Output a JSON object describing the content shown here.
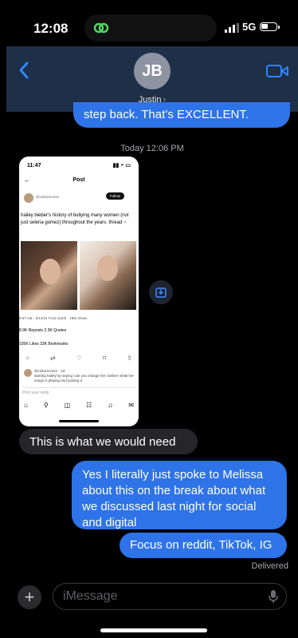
{
  "status_bar": {
    "time": "12:08",
    "network": "5G"
  },
  "header": {
    "initials": "JB",
    "contact_name": "Justin",
    "chevron": "›"
  },
  "messages": {
    "top_outgoing": "step back.  That’s EXCELLENT.",
    "timestamp": "Today 12:06 PM",
    "incoming_1": "This is what we would need",
    "outgoing_1": "Yes I literally just spoke to Melissa about this on the break about what we discussed last night for social and digital",
    "outgoing_2": "Focus on reddit, TikTok, IG",
    "delivered": "Delivered"
  },
  "attachment": {
    "time": "11:47",
    "title": "Post",
    "handle": "@culturecrave",
    "follow": "Follow",
    "body": "hailey bieber's history of bullying many women (not just selena gomez) throughout the years. thread ~",
    "meta": "8:57 AM · 9/14/24 From Earth · 19M Views",
    "reposts": "8.9K Reposts  2.3K Quotes",
    "likes": "105K Likes  33K Bookmarks",
    "reply_handle": "@culturecrave · 1d",
    "reply_text": "starting hailey by saying 'can you change the clothes' while her songs is playing and posting it",
    "post_reply": "Post your reply"
  },
  "composer": {
    "placeholder": "iMessage"
  },
  "colors": {
    "outgoing_bubble": "#2e73e8",
    "incoming_bubble": "#26262a",
    "header_bg": "#1e2f48"
  }
}
